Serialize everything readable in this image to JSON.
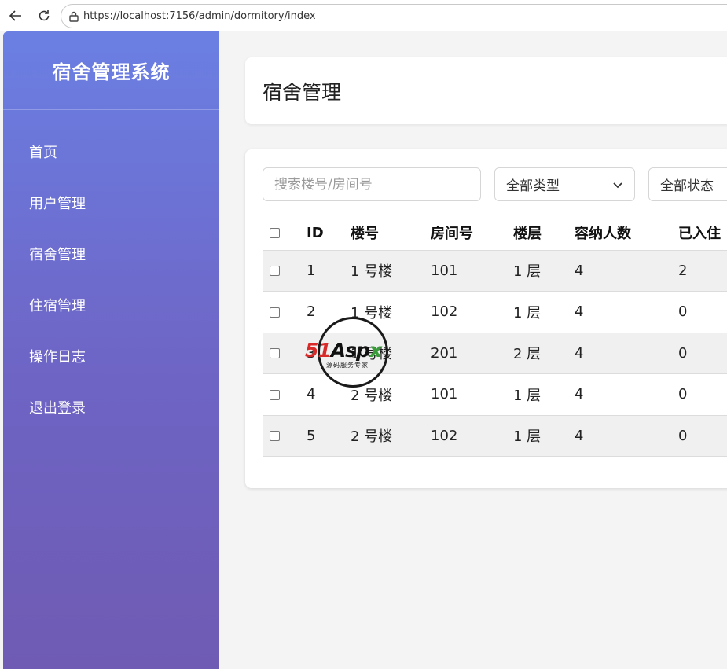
{
  "browser": {
    "url": "https://localhost:7156/admin/dormitory/index"
  },
  "sidebar": {
    "title": "宿舍管理系统",
    "items": [
      {
        "label": "首页"
      },
      {
        "label": "用户管理"
      },
      {
        "label": "宿舍管理"
      },
      {
        "label": "住宿管理"
      },
      {
        "label": "操作日志"
      },
      {
        "label": "退出登录"
      }
    ]
  },
  "header": {
    "title": "宿舍管理"
  },
  "filters": {
    "search_placeholder": "搜索楼号/房间号",
    "type_select": "全部类型",
    "status_select": "全部状态"
  },
  "table": {
    "headers": [
      "ID",
      "楼号",
      "房间号",
      "楼层",
      "容纳人数",
      "已入住"
    ],
    "rows": [
      {
        "id": "1",
        "building": "1 号楼",
        "room": "101",
        "floor": "1 层",
        "capacity": "4",
        "occupied": "2"
      },
      {
        "id": "2",
        "building": "1 号楼",
        "room": "102",
        "floor": "1 层",
        "capacity": "4",
        "occupied": "0"
      },
      {
        "id": "3",
        "building": "1 号楼",
        "room": "201",
        "floor": "2 层",
        "capacity": "4",
        "occupied": "0"
      },
      {
        "id": "4",
        "building": "2 号楼",
        "room": "101",
        "floor": "1 层",
        "capacity": "4",
        "occupied": "0"
      },
      {
        "id": "5",
        "building": "2 号楼",
        "room": "102",
        "floor": "1 层",
        "capacity": "4",
        "occupied": "0"
      }
    ]
  },
  "watermark": {
    "logo_51": "51",
    "logo_asp": "Asp",
    "logo_x": "x",
    "subtitle": "源码服务专家"
  },
  "colors": {
    "sidebar_top": "#6b7fe3",
    "sidebar_bottom": "#6f5bb3"
  }
}
